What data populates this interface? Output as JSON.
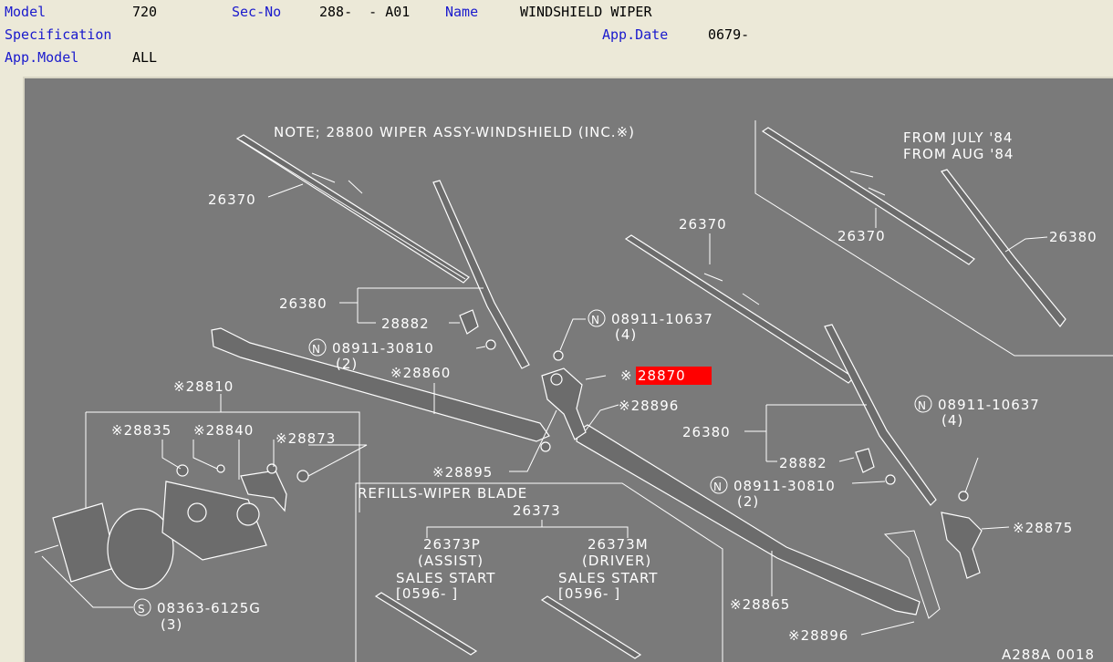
{
  "header": {
    "model_label": "Model",
    "model_value": "720",
    "secno_label": "Sec-No",
    "secno_value": "288-  - A01",
    "name_label": "Name",
    "name_value": "WINDSHIELD WIPER",
    "spec_label": "Specification",
    "appdate_label": "App.Date",
    "appdate_value": "0679-",
    "appmodel_label": "App.Model",
    "appmodel_value": "ALL"
  },
  "diagram": {
    "note": "NOTE; 28800 WIPER ASSY-WINDSHIELD (INC.※)",
    "from_july": "FROM JULY '84",
    "from_aug": "FROM AUG '84",
    "refills_title": "REFILLS-WIPER BLADE",
    "refills_part": "26373",
    "assist_part": "26373P",
    "assist_label": "(ASSIST)",
    "assist_sales": "SALES START",
    "assist_date": "[0596-    ]",
    "driver_part": "26373M",
    "driver_label": "(DRIVER)",
    "driver_sales": "SALES START",
    "driver_date": "[0596-    ]",
    "drawing_id": "A288A 0018",
    "callouts": {
      "c26370a": "26370",
      "c26370b": "26370",
      "c26370c": "26370",
      "c26380a": "26380",
      "c26380b": "26380",
      "c26380c": "26380",
      "c28882a": "28882",
      "c28882b": "28882",
      "n0891110637a": "08911-10637",
      "n0891110637a_qty": "(4)",
      "n0891110637b": "08911-10637",
      "n0891110637b_qty": "(4)",
      "n0891130810a": "08911-30810",
      "n0891130810a_qty": "(2)",
      "n0891130810b": "08911-30810",
      "n0891130810b_qty": "(2)",
      "s083636125g": "08363-6125G",
      "s083636125g_qty": "(3)",
      "c28810": "※28810",
      "c28835": "※28835",
      "c28840": "※28840",
      "c28873": "※28873",
      "c28860": "※28860",
      "c28895": "※28895",
      "c28870_prefix": "※",
      "c28870": "28870",
      "c28896a": "※28896",
      "c28896b": "※28896",
      "c28875": "※28875",
      "c28865": "※28865",
      "n_symbol": "N",
      "s_symbol": "S"
    },
    "highlight_color": "#ff0000"
  }
}
